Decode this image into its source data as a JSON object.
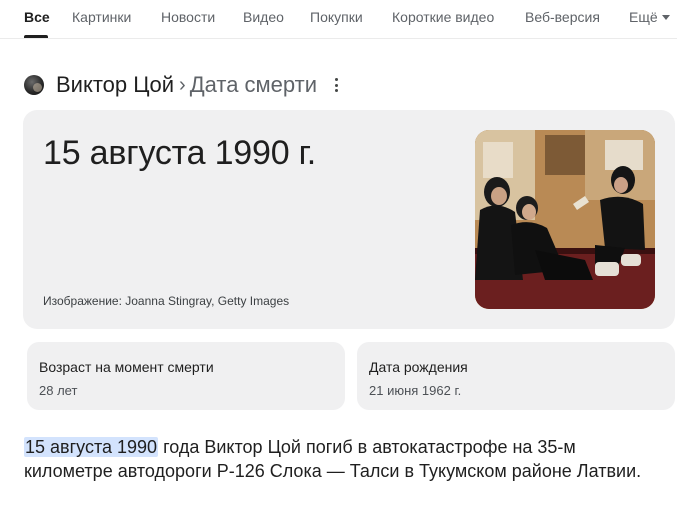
{
  "tabs": {
    "all": "Все",
    "images": "Картинки",
    "news": "Новости",
    "video": "Видео",
    "shopping": "Покупки",
    "short_video": "Короткие видео",
    "web": "Веб-версия",
    "more": "Ещё"
  },
  "breadcrumb": {
    "entity": "Виктор Цой",
    "separator": "›",
    "attribute": "Дата смерти"
  },
  "answer": {
    "date": "15 августа 1990 г.",
    "image_credit": "Изображение: Joanna Stingray, Getty Images"
  },
  "facts": {
    "age_label": "Возраст на момент смерти",
    "age_value": "28 лет",
    "birth_label": "Дата рождения",
    "birth_value": "21 июня 1962 г."
  },
  "snippet": {
    "highlight": "15 августа 1990",
    "text": " года Виктор Цой погиб в автокатастрофе на 35-м километре автодороги Р-126 Слока — Талси в Тукумском районе Латвии."
  },
  "colors": {
    "card_bg": "#f0f0f1",
    "highlight_bg": "#d3e3fd",
    "muted_text": "#5f6368"
  }
}
